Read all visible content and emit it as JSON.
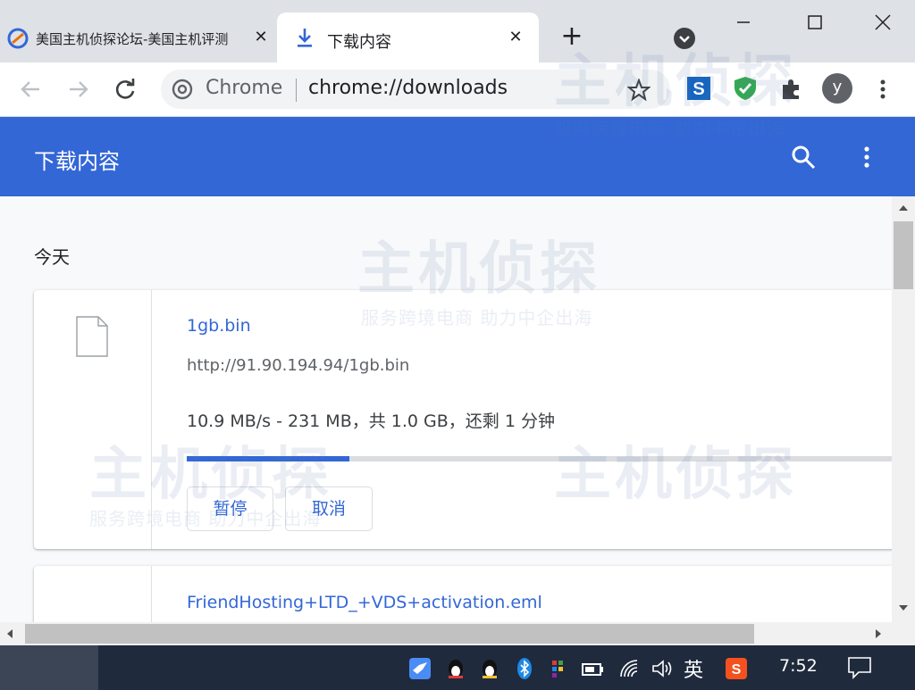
{
  "tabs": [
    {
      "title": "美国主机侦探论坛-美国主机评测",
      "active": false
    },
    {
      "title": "下载内容",
      "active": true
    }
  ],
  "omnibox": {
    "chip_label": "Chrome",
    "url": "chrome://downloads"
  },
  "profile": {
    "initial": "y"
  },
  "downloads_page": {
    "title": "下载内容",
    "section_label": "今天",
    "items": [
      {
        "filename": "1gb.bin",
        "url": "http://91.90.194.94/1gb.bin",
        "status": "10.9 MB/s - 231 MB，共 1.0 GB，还剩 1 分钟",
        "progress": 0.23,
        "pause_label": "暂停",
        "cancel_label": "取消"
      },
      {
        "filename": "FriendHosting+LTD_+VDS+activation.eml"
      }
    ]
  },
  "taskbar": {
    "ime": "英",
    "clock": "7:52"
  },
  "watermark": {
    "brand": "主机侦探",
    "slogan": "服务跨境电商 助力中企出海"
  },
  "colors": {
    "accent": "#3367d6",
    "header_bg": "#3367d6",
    "taskbar_bg": "#1f2a3d"
  },
  "icons": [
    "browser-favicon-icon",
    "download-icon",
    "close-icon",
    "plus-icon",
    "tab-search-icon",
    "minimize-icon",
    "maximize-icon",
    "window-close-icon",
    "back-icon",
    "forward-icon",
    "reload-icon",
    "chrome-icon",
    "star-icon",
    "extension-s-icon",
    "shield-check-icon",
    "puzzle-icon",
    "more-vert-icon",
    "search-icon",
    "file-icon",
    "scroll-up-icon",
    "scroll-down-icon",
    "scroll-left-icon",
    "scroll-right-icon",
    "bird-icon",
    "qq-icon",
    "bluetooth-icon",
    "battery-icon",
    "wifi-icon",
    "volume-icon",
    "sogou-icon",
    "notification-icon"
  ]
}
